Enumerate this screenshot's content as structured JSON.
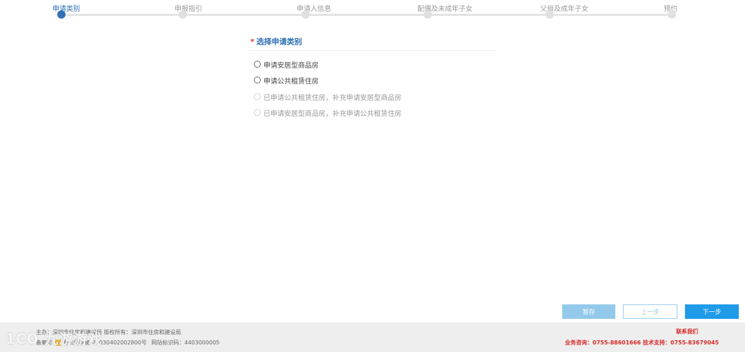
{
  "stepper": {
    "steps": [
      {
        "label": "申请类别",
        "active": true
      },
      {
        "label": "申报指引",
        "active": false
      },
      {
        "label": "申请人信息",
        "active": false
      },
      {
        "label": "配偶及未成年子女",
        "active": false
      },
      {
        "label": "父母及成年子女",
        "active": false
      },
      {
        "label": "预约",
        "active": false
      }
    ]
  },
  "form": {
    "required_mark": "*",
    "section_title": "选择申请类别",
    "options": [
      {
        "label": "申请安居型商品房",
        "enabled": true
      },
      {
        "label": "申请公共租赁住房",
        "enabled": true
      },
      {
        "label": "已申请公共租赁住房，补充申请安居型商品房",
        "enabled": false
      },
      {
        "label": "已申请安居型商品房，补充申请公共租赁住房",
        "enabled": false
      }
    ]
  },
  "actions": {
    "save_label": "暂存",
    "prev_label": "上一步",
    "next_label": "下一步"
  },
  "footer": {
    "line1": "主办：深圳市住房和建设局 版权所有：深圳市住房和建设局",
    "line2_prefix": "备案号",
    "police_record": "粤公网安备 44030402002800号",
    "site_code": "网站标识码：4403000005",
    "contact_title": "联系我们",
    "contact_info": "业务咨询：0755-88601666 技术支持：0755-83679045"
  },
  "watermark": "1CO 九游游戏"
}
